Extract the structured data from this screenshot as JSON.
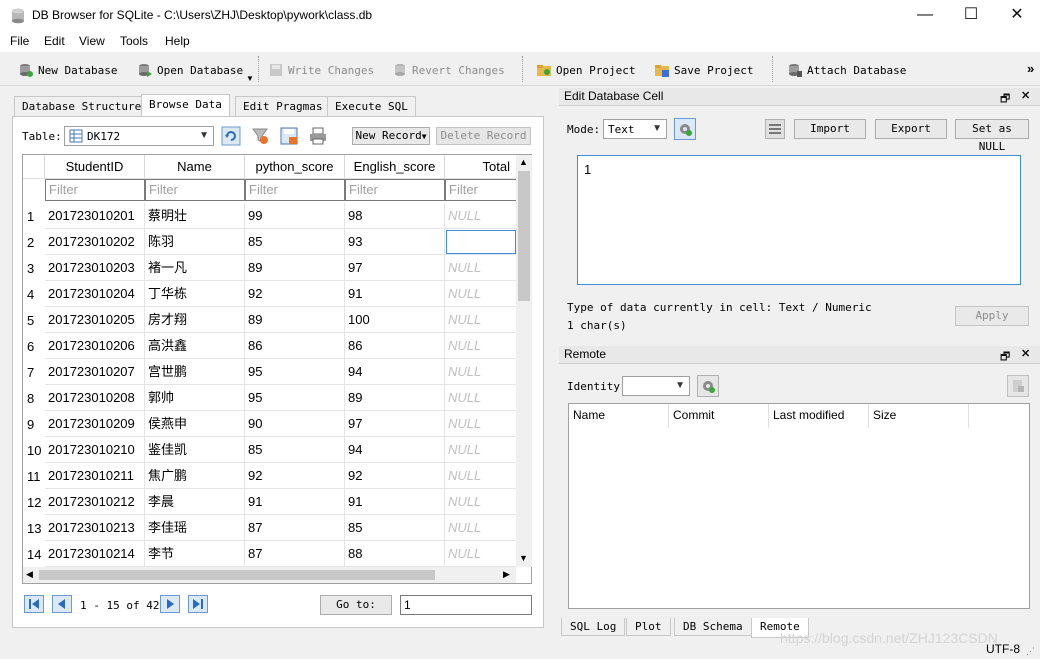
{
  "window": {
    "title": "DB Browser for SQLite - C:\\Users\\ZHJ\\Desktop\\pywork\\class.db",
    "minimize": "—",
    "maximize": "☐",
    "close": "✕"
  },
  "menu": [
    "File",
    "Edit",
    "View",
    "Tools",
    "Help"
  ],
  "toolbar": {
    "new_database": "New Database",
    "open_database": "Open Database",
    "write_changes": "Write Changes",
    "revert_changes": "Revert Changes",
    "open_project": "Open Project",
    "save_project": "Save Project",
    "attach_database": "Attach Database",
    "overflow": "»"
  },
  "tabs": [
    "Database Structure",
    "Browse Data",
    "Edit Pragmas",
    "Execute SQL"
  ],
  "browse": {
    "table_label": "Table:",
    "table_value": "DK172",
    "new_record": "New Record",
    "delete_record": "Delete Record",
    "columns": [
      "StudentID",
      "Name",
      "python_score",
      "English_score",
      "Total"
    ],
    "filter_placeholder": "Filter",
    "rows": [
      {
        "num": "1",
        "id": "201723010201",
        "name": "蔡明壮",
        "py": "99",
        "en": "98",
        "total": "NULL"
      },
      {
        "num": "2",
        "id": "201723010202",
        "name": "陈羽",
        "py": "85",
        "en": "93",
        "total": ""
      },
      {
        "num": "3",
        "id": "201723010203",
        "name": "褚一凡",
        "py": "89",
        "en": "97",
        "total": "NULL"
      },
      {
        "num": "4",
        "id": "201723010204",
        "name": "丁华栋",
        "py": "92",
        "en": "91",
        "total": "NULL"
      },
      {
        "num": "5",
        "id": "201723010205",
        "name": "房才翔",
        "py": "89",
        "en": "100",
        "total": "NULL"
      },
      {
        "num": "6",
        "id": "201723010206",
        "name": "高洪鑫",
        "py": "86",
        "en": "86",
        "total": "NULL"
      },
      {
        "num": "7",
        "id": "201723010207",
        "name": "宫世鹏",
        "py": "95",
        "en": "94",
        "total": "NULL"
      },
      {
        "num": "8",
        "id": "201723010208",
        "name": "郭帅",
        "py": "95",
        "en": "89",
        "total": "NULL"
      },
      {
        "num": "9",
        "id": "201723010209",
        "name": "侯燕申",
        "py": "90",
        "en": "97",
        "total": "NULL"
      },
      {
        "num": "10",
        "id": "201723010210",
        "name": "鉴佳凯",
        "py": "85",
        "en": "94",
        "total": "NULL"
      },
      {
        "num": "11",
        "id": "201723010211",
        "name": "焦广鹏",
        "py": "92",
        "en": "92",
        "total": "NULL"
      },
      {
        "num": "12",
        "id": "201723010212",
        "name": "李晨",
        "py": "91",
        "en": "91",
        "total": "NULL"
      },
      {
        "num": "13",
        "id": "201723010213",
        "name": "李佳瑶",
        "py": "87",
        "en": "85",
        "total": "NULL"
      },
      {
        "num": "14",
        "id": "201723010214",
        "name": "李节",
        "py": "87",
        "en": "88",
        "total": "NULL"
      }
    ],
    "pagination": "1 - 15 of 42",
    "goto_label": "Go to:",
    "goto_value": "1"
  },
  "edit_cell": {
    "title": "Edit Database Cell",
    "mode_label": "Mode:",
    "mode_value": "Text",
    "import": "Import",
    "export": "Export",
    "set_null": "Set as NULL",
    "content": "1",
    "type_info": "Type of data currently in cell: Text / Numeric",
    "size_info": "1 char(s)",
    "apply": "Apply"
  },
  "remote": {
    "title": "Remote",
    "identity_label": "Identity",
    "columns": [
      "Name",
      "Commit",
      "Last modified",
      "Size"
    ]
  },
  "bottom_tabs": [
    "SQL Log",
    "Plot",
    "DB Schema",
    "Remote"
  ],
  "status": {
    "watermark": "https://blog.csdn.net/ZHJ123CSDN",
    "encoding": "UTF-8"
  },
  "colors": {
    "accent": "#3c8fd6",
    "null_text": "#c0c0c0",
    "selected_border": "#3c8fd6"
  }
}
